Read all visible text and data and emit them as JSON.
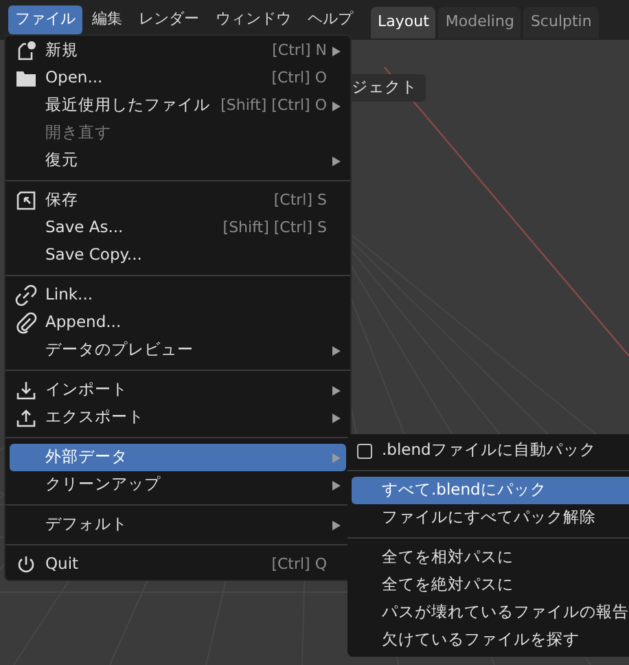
{
  "menubar": [
    {
      "label": "ファイル",
      "selected": true
    },
    {
      "label": "編集",
      "selected": false
    },
    {
      "label": "レンダー",
      "selected": false
    },
    {
      "label": "ウィンドウ",
      "selected": false
    },
    {
      "label": "ヘルプ",
      "selected": false
    }
  ],
  "workspaces": [
    {
      "label": "Layout",
      "selected": true
    },
    {
      "label": "Modeling",
      "selected": false
    },
    {
      "label": "Sculptin",
      "selected": false
    }
  ],
  "header_button": "ジェクト",
  "file_menu": [
    [
      {
        "label": "新規",
        "shortcut": "[Ctrl] N",
        "submenu": true,
        "disabled": false,
        "selected": false
      },
      {
        "label": "Open...",
        "shortcut": "[Ctrl] O",
        "submenu": false,
        "disabled": false,
        "selected": false
      },
      {
        "label": "最近使用したファイル",
        "shortcut": "[Shift] [Ctrl] O",
        "submenu": true,
        "disabled": false,
        "selected": false
      },
      {
        "label": "開き直す",
        "submenu": false,
        "disabled": true,
        "selected": false
      },
      {
        "label": "復元",
        "submenu": true,
        "disabled": false,
        "selected": false
      }
    ],
    [
      {
        "label": "保存",
        "shortcut": "[Ctrl] S",
        "submenu": false,
        "disabled": false,
        "selected": false
      },
      {
        "label": "Save As...",
        "shortcut": "[Shift] [Ctrl] S",
        "submenu": false,
        "disabled": false,
        "selected": false
      },
      {
        "label": "Save Copy...",
        "submenu": false,
        "disabled": false,
        "selected": false
      }
    ],
    [
      {
        "label": "Link...",
        "submenu": false,
        "disabled": false,
        "selected": false
      },
      {
        "label": "Append...",
        "submenu": false,
        "disabled": false,
        "selected": false
      },
      {
        "label": "データのプレビュー",
        "submenu": true,
        "disabled": false,
        "selected": false
      }
    ],
    [
      {
        "label": "インポート",
        "submenu": true,
        "disabled": false,
        "selected": false
      },
      {
        "label": "エクスポート",
        "submenu": true,
        "disabled": false,
        "selected": false
      }
    ],
    [
      {
        "label": "外部データ",
        "submenu": true,
        "disabled": false,
        "selected": true
      },
      {
        "label": "クリーンアップ",
        "submenu": true,
        "disabled": false,
        "selected": false
      }
    ],
    [
      {
        "label": "デフォルト",
        "submenu": true,
        "disabled": false,
        "selected": false
      }
    ],
    [
      {
        "label": "Quit",
        "shortcut": "[Ctrl] Q",
        "submenu": false,
        "disabled": false,
        "selected": false
      }
    ]
  ],
  "external_data_menu": [
    [
      {
        "kind": "checkbox",
        "label": ".blendファイルに自動パック",
        "checked": false,
        "selected": false
      }
    ],
    [
      {
        "kind": "action",
        "label": "すべて.blendにパック",
        "selected": true
      },
      {
        "kind": "action",
        "label": "ファイルにすべてパック解除",
        "selected": false
      }
    ],
    [
      {
        "kind": "action",
        "label": "全てを相対パスに",
        "selected": false
      },
      {
        "kind": "action",
        "label": "全てを絶対パスに",
        "selected": false
      },
      {
        "kind": "action",
        "label": "パスが壊れているファイルの報告",
        "selected": false
      },
      {
        "kind": "action",
        "label": "欠けているファイルを探す",
        "selected": false
      }
    ]
  ]
}
